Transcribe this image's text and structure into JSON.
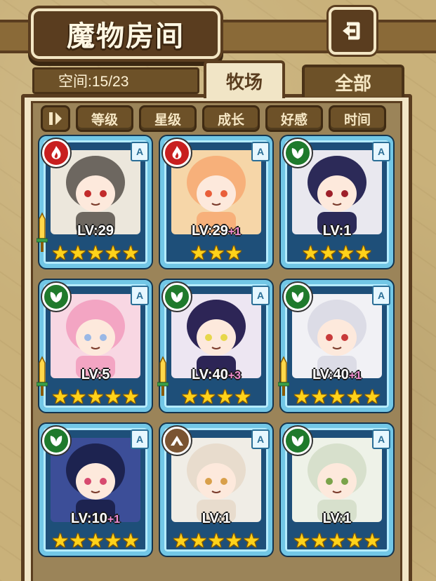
{
  "header": {
    "title": "魔物房间",
    "back_icon": "back-arrow-icon"
  },
  "space": {
    "label": "空间:15/23"
  },
  "tabs": [
    {
      "label": "牧场",
      "active": true
    },
    {
      "label": "全部",
      "active": false
    }
  ],
  "sort": {
    "toggle_icon": "sort-order-icon",
    "buttons": [
      "等级",
      "星级",
      "成长",
      "好感",
      "时间"
    ]
  },
  "cards": [
    {
      "element": "fire",
      "rank": "A",
      "level": "LV:29",
      "bonus": "",
      "stars": 5,
      "weapon": true,
      "palette": [
        "#ece7dc",
        "#6d6760",
        "#c22b2b"
      ]
    },
    {
      "element": "fire",
      "rank": "A",
      "level": "LV:29",
      "bonus": "+1",
      "stars": 3,
      "weapon": false,
      "palette": [
        "#f6d6a8",
        "#f7b07a",
        "#e95f3a"
      ]
    },
    {
      "element": "grass",
      "rank": "A",
      "level": "LV:1",
      "bonus": "",
      "stars": 4,
      "weapon": false,
      "palette": [
        "#e9e8ef",
        "#2c2a58",
        "#9e1f2a"
      ]
    },
    {
      "element": "grass",
      "rank": "A",
      "level": "LV:5",
      "bonus": "",
      "stars": 5,
      "weapon": true,
      "palette": [
        "#f8d7e3",
        "#f3a5c3",
        "#9ab8e6"
      ]
    },
    {
      "element": "grass",
      "rank": "A",
      "level": "LV:40",
      "bonus": "+3",
      "stars": 4,
      "weapon": true,
      "palette": [
        "#ede6f2",
        "#2d2556",
        "#e7d74a"
      ]
    },
    {
      "element": "grass",
      "rank": "A",
      "level": "LV:40",
      "bonus": "+1",
      "stars": 5,
      "weapon": true,
      "palette": [
        "#f1f1f5",
        "#dcdce6",
        "#c83a3a"
      ]
    },
    {
      "element": "grass",
      "rank": "A",
      "level": "LV:10",
      "bonus": "+1",
      "stars": 5,
      "weapon": false,
      "palette": [
        "#3c4e98",
        "#1d2350",
        "#d74a6f"
      ]
    },
    {
      "element": "earth",
      "rank": "A",
      "level": "LV:1",
      "bonus": "",
      "stars": 5,
      "weapon": false,
      "palette": [
        "#f0ede6",
        "#e8dccd",
        "#d9a04a"
      ]
    },
    {
      "element": "grass",
      "rank": "A",
      "level": "LV:1",
      "bonus": "",
      "stars": 5,
      "weapon": false,
      "palette": [
        "#eef2e8",
        "#d7e0cc",
        "#7aa34a"
      ]
    }
  ]
}
